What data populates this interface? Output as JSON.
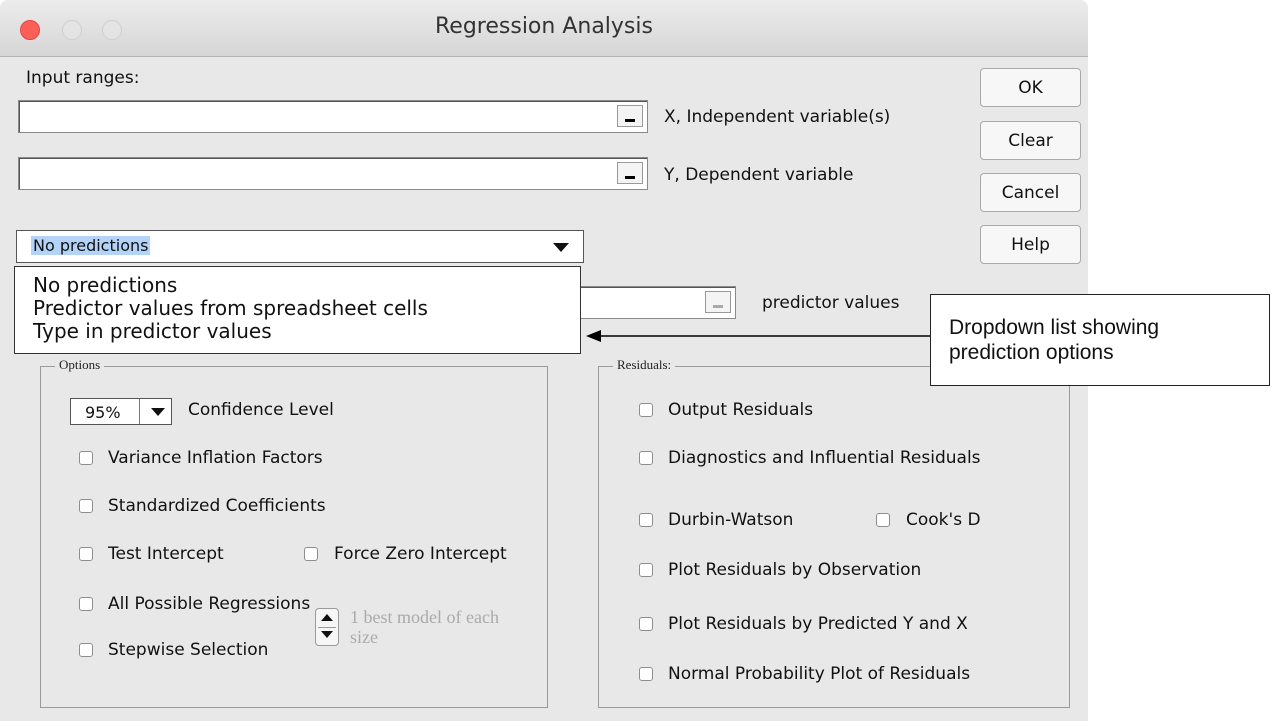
{
  "window": {
    "title": "Regression Analysis"
  },
  "input_ranges": {
    "heading": "Input ranges:",
    "x_label": "X, Independent variable(s)",
    "y_label": "Y, Dependent variable",
    "x_value": "",
    "y_value": ""
  },
  "buttons": {
    "ok": "OK",
    "clear": "Clear",
    "cancel": "Cancel",
    "help": "Help"
  },
  "predictions": {
    "selected": "No predictions",
    "options": [
      "No predictions",
      "Predictor values from spreadsheet cells",
      "Type in predictor values"
    ],
    "predictor_label": "predictor values"
  },
  "options": {
    "legend": "Options",
    "confidence_value": "95%",
    "confidence_label": "Confidence Level",
    "variance": "Variance Inflation Factors",
    "standardized": "Standardized Coefficients",
    "test_intercept": "Test Intercept",
    "force_zero": "Force Zero Intercept",
    "all_possible": "All Possible Regressions",
    "stepwise": "Stepwise Selection",
    "stepwise_hint": "1 best model of each size"
  },
  "residuals": {
    "legend": "Residuals:",
    "output": "Output Residuals",
    "diagnostics": "Diagnostics and Influential Residuals",
    "durbin": "Durbin-Watson",
    "cooks": "Cook's D",
    "plot_obs": "Plot Residuals by Observation",
    "plot_pred": "Plot Residuals by Predicted Y and X",
    "normal": "Normal Probability Plot of Residuals"
  },
  "callout": {
    "text": "Dropdown list showing\nprediction options"
  },
  "colors": {
    "selection": "#b3d3f9",
    "close": "#fc5f57",
    "dialog_bg": "#e8e8e8"
  }
}
